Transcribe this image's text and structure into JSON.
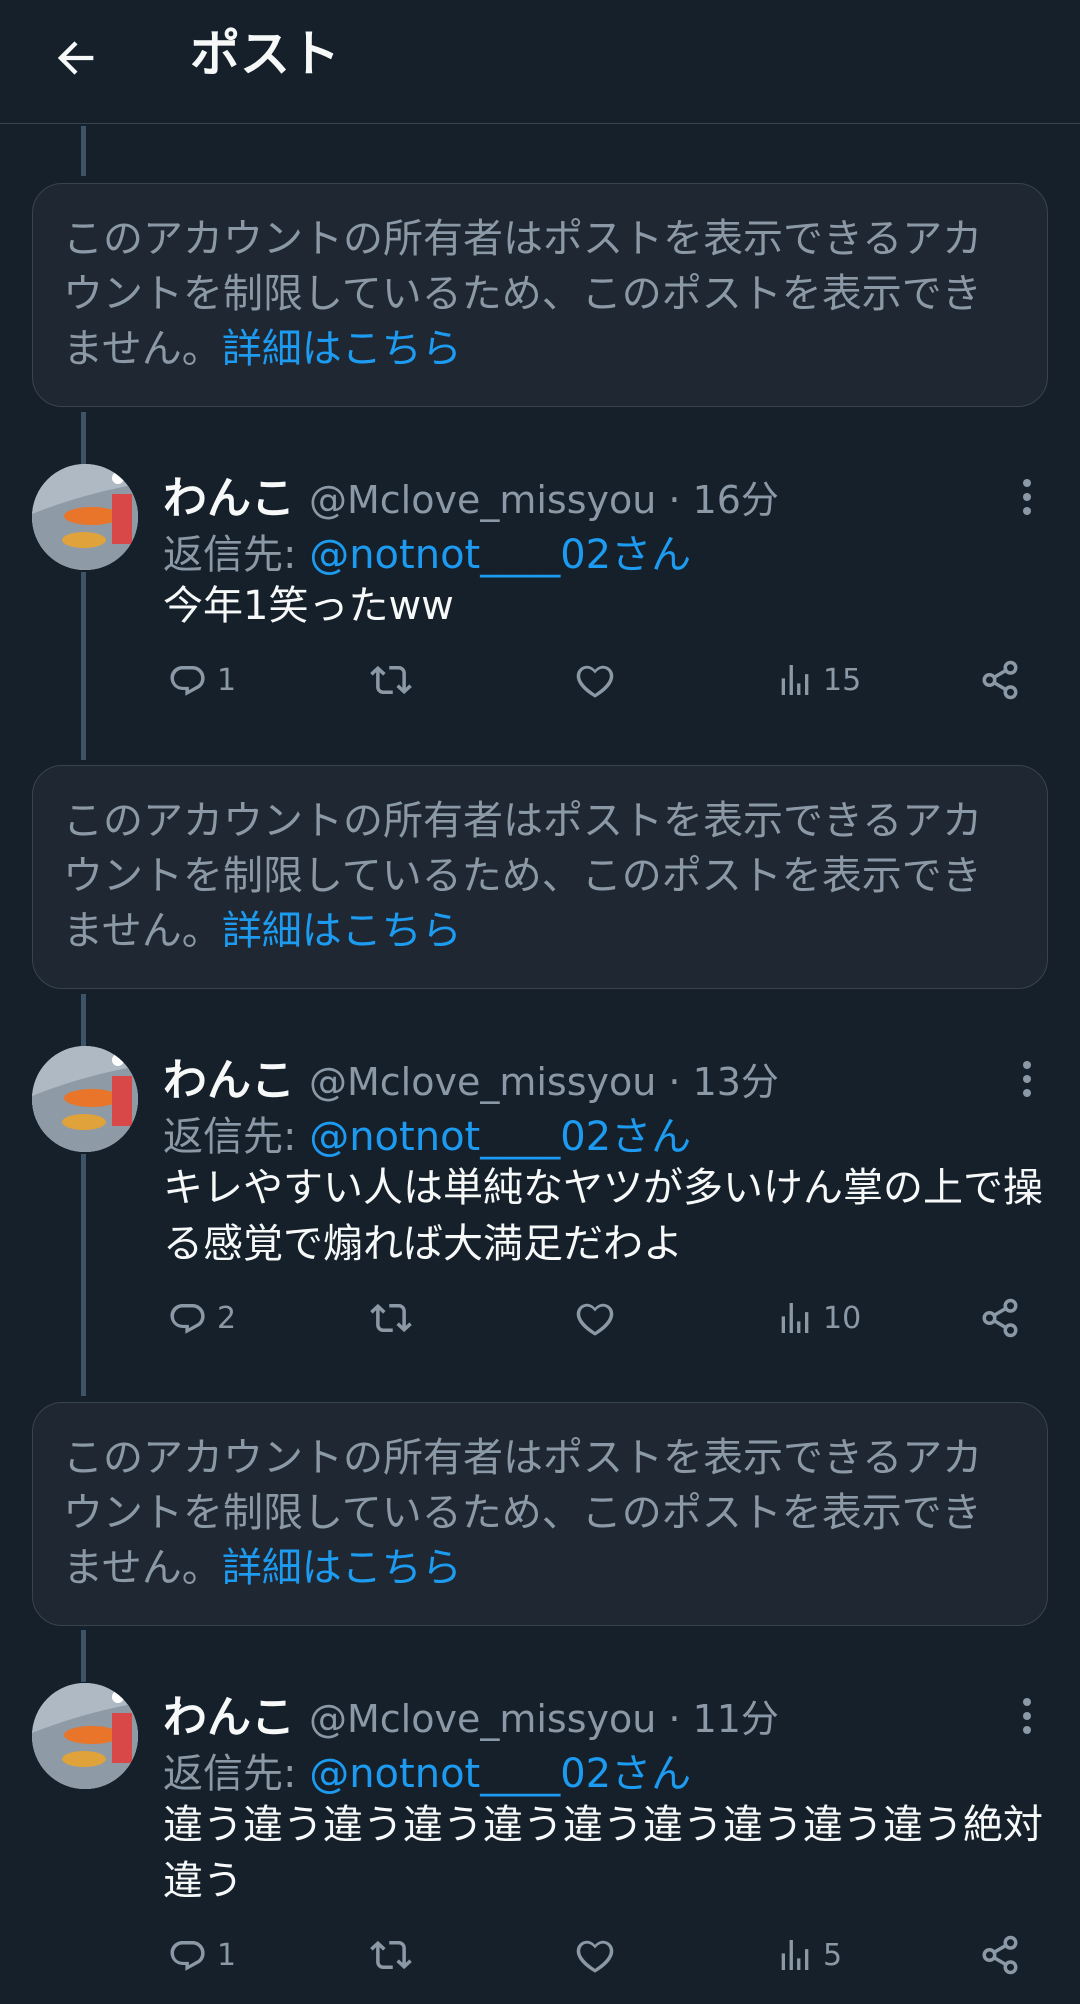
{
  "header": {
    "title": "ポスト"
  },
  "restricted_notice": {
    "text": "このアカウントの所有者はポストを表示できるアカウントを制限しているため、このポストを表示できません。",
    "link": "詳細はこちら"
  },
  "posts": [
    {
      "display_name": "わんこ",
      "handle": "@Mclove_missyou · 16分",
      "reply_prefix": "返信先: ",
      "reply_mention": "@notnot____02さん",
      "text": "今年1笑ったww",
      "replies": "1",
      "retweets": "",
      "likes": "",
      "views": "15"
    },
    {
      "display_name": "わんこ",
      "handle": "@Mclove_missyou · 13分",
      "reply_prefix": "返信先: ",
      "reply_mention": "@notnot____02さん",
      "text": "キレやすい人は単純なヤツが多いけん掌の上で操る感覚で煽れば大満足だわよ",
      "replies": "2",
      "retweets": "",
      "likes": "",
      "views": "10"
    },
    {
      "display_name": "わんこ",
      "handle": "@Mclove_missyou · 11分",
      "reply_prefix": "返信先: ",
      "reply_mention": "@notnot____02さん",
      "text": "違う違う違う違う違う違う違う違う違う違う絶対違う",
      "replies": "1",
      "retweets": "",
      "likes": "",
      "views": "5"
    }
  ],
  "colors": {
    "background": "#15202b",
    "accent": "#1d9bf0",
    "secondary_text": "#8b98a5",
    "border": "#38444d"
  },
  "icons": [
    "back-arrow-icon",
    "more-vertical-icon",
    "reply-icon",
    "retweet-icon",
    "like-icon",
    "views-icon",
    "share-icon"
  ]
}
